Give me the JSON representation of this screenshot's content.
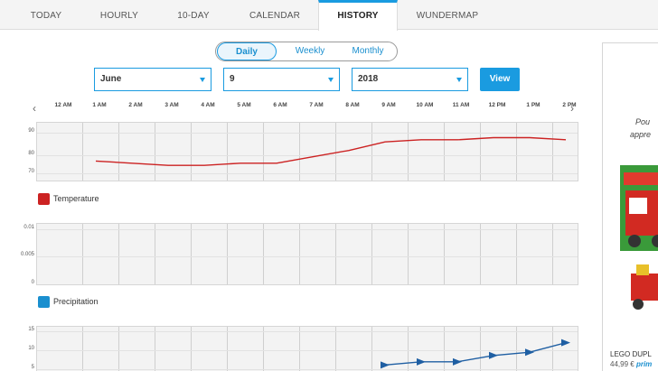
{
  "tabs": [
    {
      "label": "TODAY",
      "active": false
    },
    {
      "label": "HOURLY",
      "active": false
    },
    {
      "label": "10-DAY",
      "active": false
    },
    {
      "label": "CALENDAR",
      "active": false
    },
    {
      "label": "HISTORY",
      "active": true
    },
    {
      "label": "WUNDERMAP",
      "active": false
    }
  ],
  "period_toggle": {
    "daily": "Daily",
    "weekly": "Weekly",
    "monthly": "Monthly",
    "selected": "Daily"
  },
  "date_select": {
    "month": "June",
    "day": "9",
    "year": "2018"
  },
  "view_button": "View",
  "nav": {
    "prev_icon": "chevron-left-icon",
    "next_icon": "chevron-right-icon"
  },
  "hours": [
    "12 AM",
    "1 AM",
    "2 AM",
    "3 AM",
    "4 AM",
    "5 AM",
    "6 AM",
    "7 AM",
    "8 AM",
    "9 AM",
    "10 AM",
    "11 AM",
    "12 PM",
    "1 PM",
    "2 PM"
  ],
  "chart_data": [
    {
      "type": "line",
      "legend": "Temperature",
      "color": "#cc2222",
      "y_ticks": [
        "90",
        "80",
        "70"
      ],
      "ylim": [
        67,
        95
      ],
      "x": [
        "1 AM",
        "2 AM",
        "3 AM",
        "4 AM",
        "5 AM",
        "6 AM",
        "7 AM",
        "8 AM",
        "9 AM",
        "10 AM",
        "11 AM",
        "12 PM",
        "1 PM",
        "2 PM"
      ],
      "values": [
        77,
        76,
        75,
        75,
        76,
        76,
        79,
        82,
        86,
        87,
        87,
        88,
        88,
        87
      ]
    },
    {
      "type": "line",
      "legend": "Precipitation",
      "color": "#1a8fcf",
      "y_ticks": [
        "0.01",
        "0.005",
        "0"
      ],
      "ylim": [
        0,
        0.012
      ],
      "x": [
        "1 AM",
        "2 AM",
        "3 AM",
        "4 AM",
        "5 AM",
        "6 AM",
        "7 AM",
        "8 AM",
        "9 AM",
        "10 AM",
        "11 AM",
        "12 PM",
        "1 PM",
        "2 PM"
      ],
      "values": [
        0,
        0,
        0,
        0,
        0,
        0,
        0,
        0,
        0,
        0,
        0,
        0,
        0,
        0
      ]
    },
    {
      "type": "line",
      "legend": "",
      "color": "#1f5fa3",
      "y_ticks": [
        "15",
        "10",
        "5"
      ],
      "ylim": [
        0,
        17
      ],
      "x": [
        "9 AM",
        "10 AM",
        "11 AM",
        "12 PM",
        "1 PM",
        "2 PM"
      ],
      "values": [
        5,
        6,
        6,
        8,
        9,
        12
      ]
    }
  ],
  "ad": {
    "text_line1": "Pou",
    "text_line2": "appre",
    "product_name": "LEGO DUPL",
    "price": "44,99 €",
    "prime": "prim"
  }
}
